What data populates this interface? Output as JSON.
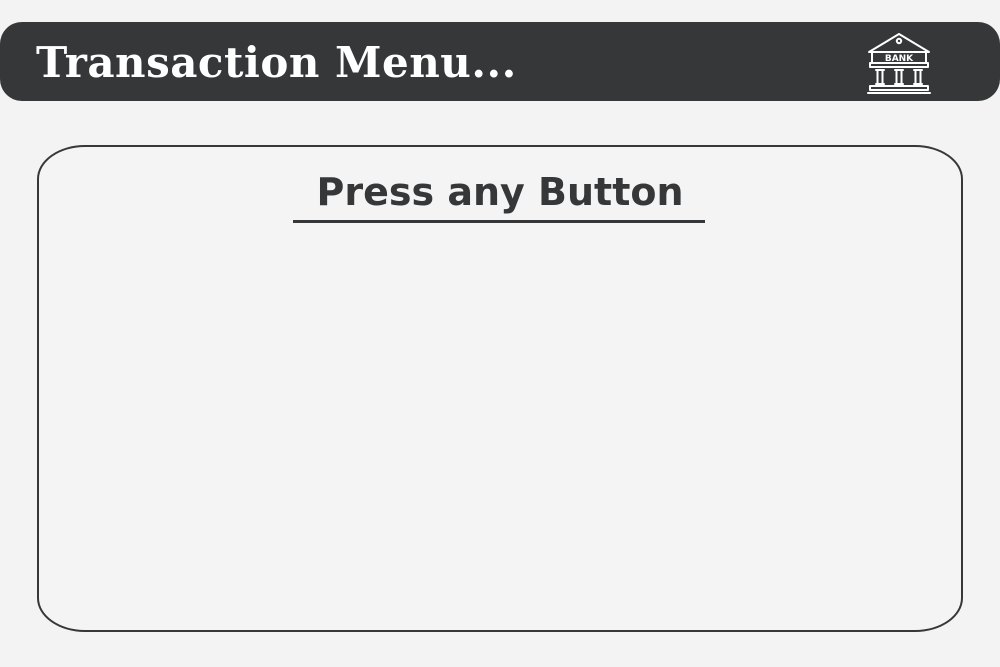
{
  "header": {
    "title": "Transaction Menu...",
    "icon": "bank-building-icon",
    "icon_label": "BANK"
  },
  "panel": {
    "heading": "Press any Button"
  },
  "colors": {
    "background": "#f3f3f3",
    "header_bg": "#363738",
    "header_text": "#ffffff",
    "panel_border": "#363738",
    "heading_text": "#363738"
  }
}
